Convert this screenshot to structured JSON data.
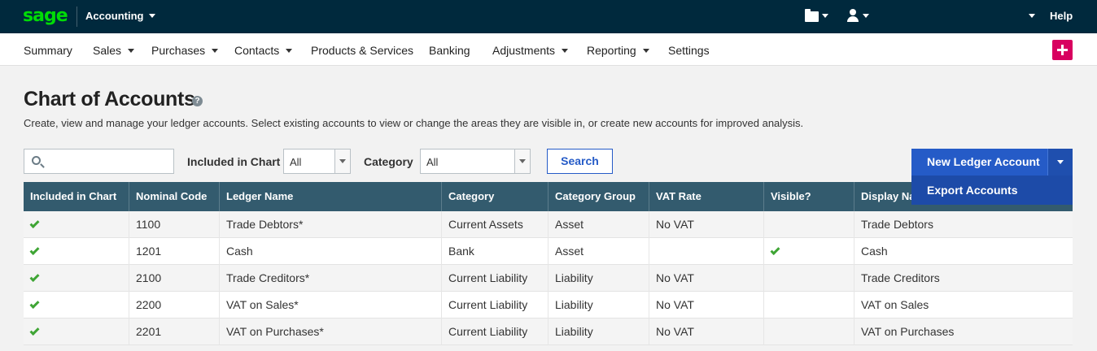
{
  "topbar": {
    "logo": "sage",
    "app_name": "Accounting",
    "help": "Help"
  },
  "nav": {
    "items": [
      {
        "label": "Summary",
        "has_caret": false
      },
      {
        "label": "Sales",
        "has_caret": true
      },
      {
        "label": "Purchases",
        "has_caret": true
      },
      {
        "label": "Contacts",
        "has_caret": true
      },
      {
        "label": "Products & Services",
        "has_caret": false
      },
      {
        "label": "Banking",
        "has_caret": false
      },
      {
        "label": "Adjustments",
        "has_caret": true
      },
      {
        "label": "Reporting",
        "has_caret": true
      },
      {
        "label": "Settings",
        "has_caret": false
      }
    ]
  },
  "page": {
    "title": "Chart of Accounts",
    "help_glyph": "?",
    "description": "Create, view and manage your ledger accounts. Select existing accounts to view or change the areas they are visible in, or create new accounts for improved analysis."
  },
  "filters": {
    "search_placeholder": "",
    "included_label": "Included in Chart",
    "included_value": "All",
    "category_label": "Category",
    "category_value": "All",
    "search_button": "Search"
  },
  "actions": {
    "new_ledger": "New Ledger Account",
    "export": "Export Accounts"
  },
  "table": {
    "headers": [
      "Included in Chart",
      "Nominal Code",
      "Ledger Name",
      "Category",
      "Category Group",
      "VAT Rate",
      "Visible?",
      "Display Name"
    ],
    "rows": [
      {
        "included": true,
        "code": "1100",
        "name": "Trade Debtors*",
        "category": "Current Assets",
        "group": "Asset",
        "vat": "No VAT",
        "visible": false,
        "display": "Trade Debtors"
      },
      {
        "included": true,
        "code": "1201",
        "name": "Cash",
        "category": "Bank",
        "group": "Asset",
        "vat": "",
        "visible": true,
        "display": "Cash"
      },
      {
        "included": true,
        "code": "2100",
        "name": "Trade Creditors*",
        "category": "Current Liability",
        "group": "Liability",
        "vat": "No VAT",
        "visible": false,
        "display": "Trade Creditors"
      },
      {
        "included": true,
        "code": "2200",
        "name": "VAT on Sales*",
        "category": "Current Liability",
        "group": "Liability",
        "vat": "No VAT",
        "visible": false,
        "display": "VAT on Sales"
      },
      {
        "included": true,
        "code": "2201",
        "name": "VAT on Purchases*",
        "category": "Current Liability",
        "group": "Liability",
        "vat": "No VAT",
        "visible": false,
        "display": "VAT on Purchases"
      }
    ]
  },
  "colors": {
    "topbar_bg": "#00293d",
    "brand_green": "#00dc06",
    "primary_blue": "#255bc7",
    "header_bg": "#335b6e",
    "check_green": "#3fa535",
    "plus_pink": "#d8005f"
  }
}
